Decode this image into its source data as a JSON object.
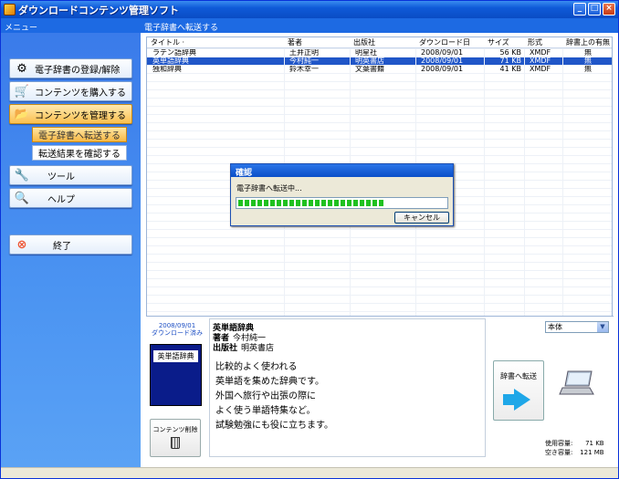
{
  "window": {
    "title": "ダウンロードコンテンツ管理ソフト"
  },
  "menu": {
    "header": "メニュー",
    "buttons": [
      {
        "label": "電子辞書の登録/解除",
        "icon": "gear-icon"
      },
      {
        "label": "コンテンツを購入する",
        "icon": "cart-icon"
      },
      {
        "label": "コンテンツを管理する",
        "icon": "folder-icon"
      },
      {
        "label": "ツール",
        "icon": "tools-icon"
      },
      {
        "label": "ヘルプ",
        "icon": "help-icon"
      },
      {
        "label": "終了",
        "icon": "close-icon"
      }
    ],
    "subitems": [
      "電子辞書へ転送する",
      "転送結果を確認する"
    ]
  },
  "main": {
    "header": "電子辞書へ転送する",
    "columns": [
      "タイトル",
      "著者",
      "出版社",
      "ダウンロード日",
      "サイズ",
      "形式",
      "辞書上の有無"
    ],
    "rows": [
      {
        "title": "ラテン語辞典",
        "author": "土井正明",
        "publisher": "明星社",
        "date": "2008/09/01",
        "size": "56 KB",
        "format": "XMDF",
        "status": "無"
      },
      {
        "title": "英単語辞典",
        "author": "今村純一",
        "publisher": "明英書店",
        "date": "2008/09/01",
        "size": "71 KB",
        "format": "XMDF",
        "status": "無"
      },
      {
        "title": "独和辞典",
        "author": "鈴木幸一",
        "publisher": "文葉書籍",
        "date": "2008/09/01",
        "size": "41 KB",
        "format": "XMDF",
        "status": "無"
      }
    ]
  },
  "dialog": {
    "title": "確認",
    "message": "電子辞書へ転送中...",
    "progress": 0.7,
    "cancel": "キャンセル"
  },
  "detail": {
    "date": "2008/09/01",
    "downloaded": "ダウンロード済み",
    "thumb_label": "英単語辞典",
    "delete_label": "コンテンツ削除",
    "book_title": "英単語辞典",
    "author_key": "著者",
    "author": "今村純一",
    "publisher_key": "出版社",
    "publisher": "明英書店",
    "description": [
      "比較的よく使われる",
      "英単語を集めた辞典です。",
      "外国へ旅行や出張の際に",
      "よく使う単語特集など。",
      "試験勉強にも役に立ちます。"
    ],
    "device": "本体",
    "transfer_label": "辞書へ転送",
    "used_key": "使用容量:",
    "used": "71 KB",
    "free_key": "空き容量:",
    "free": "121 MB"
  }
}
